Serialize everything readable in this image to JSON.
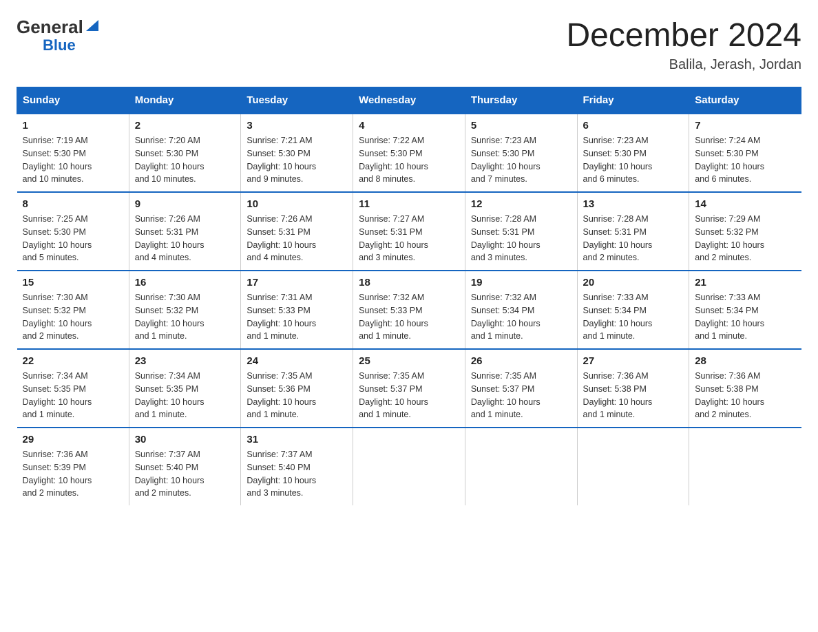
{
  "logo": {
    "general": "General",
    "blue": "Blue"
  },
  "title": "December 2024",
  "subtitle": "Balila, Jerash, Jordan",
  "days_of_week": [
    "Sunday",
    "Monday",
    "Tuesday",
    "Wednesday",
    "Thursday",
    "Friday",
    "Saturday"
  ],
  "weeks": [
    [
      {
        "day": "1",
        "sunrise": "7:19 AM",
        "sunset": "5:30 PM",
        "daylight": "10 hours and 10 minutes."
      },
      {
        "day": "2",
        "sunrise": "7:20 AM",
        "sunset": "5:30 PM",
        "daylight": "10 hours and 10 minutes."
      },
      {
        "day": "3",
        "sunrise": "7:21 AM",
        "sunset": "5:30 PM",
        "daylight": "10 hours and 9 minutes."
      },
      {
        "day": "4",
        "sunrise": "7:22 AM",
        "sunset": "5:30 PM",
        "daylight": "10 hours and 8 minutes."
      },
      {
        "day": "5",
        "sunrise": "7:23 AM",
        "sunset": "5:30 PM",
        "daylight": "10 hours and 7 minutes."
      },
      {
        "day": "6",
        "sunrise": "7:23 AM",
        "sunset": "5:30 PM",
        "daylight": "10 hours and 6 minutes."
      },
      {
        "day": "7",
        "sunrise": "7:24 AM",
        "sunset": "5:30 PM",
        "daylight": "10 hours and 6 minutes."
      }
    ],
    [
      {
        "day": "8",
        "sunrise": "7:25 AM",
        "sunset": "5:30 PM",
        "daylight": "10 hours and 5 minutes."
      },
      {
        "day": "9",
        "sunrise": "7:26 AM",
        "sunset": "5:31 PM",
        "daylight": "10 hours and 4 minutes."
      },
      {
        "day": "10",
        "sunrise": "7:26 AM",
        "sunset": "5:31 PM",
        "daylight": "10 hours and 4 minutes."
      },
      {
        "day": "11",
        "sunrise": "7:27 AM",
        "sunset": "5:31 PM",
        "daylight": "10 hours and 3 minutes."
      },
      {
        "day": "12",
        "sunrise": "7:28 AM",
        "sunset": "5:31 PM",
        "daylight": "10 hours and 3 minutes."
      },
      {
        "day": "13",
        "sunrise": "7:28 AM",
        "sunset": "5:31 PM",
        "daylight": "10 hours and 2 minutes."
      },
      {
        "day": "14",
        "sunrise": "7:29 AM",
        "sunset": "5:32 PM",
        "daylight": "10 hours and 2 minutes."
      }
    ],
    [
      {
        "day": "15",
        "sunrise": "7:30 AM",
        "sunset": "5:32 PM",
        "daylight": "10 hours and 2 minutes."
      },
      {
        "day": "16",
        "sunrise": "7:30 AM",
        "sunset": "5:32 PM",
        "daylight": "10 hours and 1 minute."
      },
      {
        "day": "17",
        "sunrise": "7:31 AM",
        "sunset": "5:33 PM",
        "daylight": "10 hours and 1 minute."
      },
      {
        "day": "18",
        "sunrise": "7:32 AM",
        "sunset": "5:33 PM",
        "daylight": "10 hours and 1 minute."
      },
      {
        "day": "19",
        "sunrise": "7:32 AM",
        "sunset": "5:34 PM",
        "daylight": "10 hours and 1 minute."
      },
      {
        "day": "20",
        "sunrise": "7:33 AM",
        "sunset": "5:34 PM",
        "daylight": "10 hours and 1 minute."
      },
      {
        "day": "21",
        "sunrise": "7:33 AM",
        "sunset": "5:34 PM",
        "daylight": "10 hours and 1 minute."
      }
    ],
    [
      {
        "day": "22",
        "sunrise": "7:34 AM",
        "sunset": "5:35 PM",
        "daylight": "10 hours and 1 minute."
      },
      {
        "day": "23",
        "sunrise": "7:34 AM",
        "sunset": "5:35 PM",
        "daylight": "10 hours and 1 minute."
      },
      {
        "day": "24",
        "sunrise": "7:35 AM",
        "sunset": "5:36 PM",
        "daylight": "10 hours and 1 minute."
      },
      {
        "day": "25",
        "sunrise": "7:35 AM",
        "sunset": "5:37 PM",
        "daylight": "10 hours and 1 minute."
      },
      {
        "day": "26",
        "sunrise": "7:35 AM",
        "sunset": "5:37 PM",
        "daylight": "10 hours and 1 minute."
      },
      {
        "day": "27",
        "sunrise": "7:36 AM",
        "sunset": "5:38 PM",
        "daylight": "10 hours and 1 minute."
      },
      {
        "day": "28",
        "sunrise": "7:36 AM",
        "sunset": "5:38 PM",
        "daylight": "10 hours and 2 minutes."
      }
    ],
    [
      {
        "day": "29",
        "sunrise": "7:36 AM",
        "sunset": "5:39 PM",
        "daylight": "10 hours and 2 minutes."
      },
      {
        "day": "30",
        "sunrise": "7:37 AM",
        "sunset": "5:40 PM",
        "daylight": "10 hours and 2 minutes."
      },
      {
        "day": "31",
        "sunrise": "7:37 AM",
        "sunset": "5:40 PM",
        "daylight": "10 hours and 3 minutes."
      },
      {
        "day": "",
        "sunrise": "",
        "sunset": "",
        "daylight": ""
      },
      {
        "day": "",
        "sunrise": "",
        "sunset": "",
        "daylight": ""
      },
      {
        "day": "",
        "sunrise": "",
        "sunset": "",
        "daylight": ""
      },
      {
        "day": "",
        "sunrise": "",
        "sunset": "",
        "daylight": ""
      }
    ]
  ],
  "labels": {
    "sunrise": "Sunrise:",
    "sunset": "Sunset:",
    "daylight": "Daylight:"
  }
}
